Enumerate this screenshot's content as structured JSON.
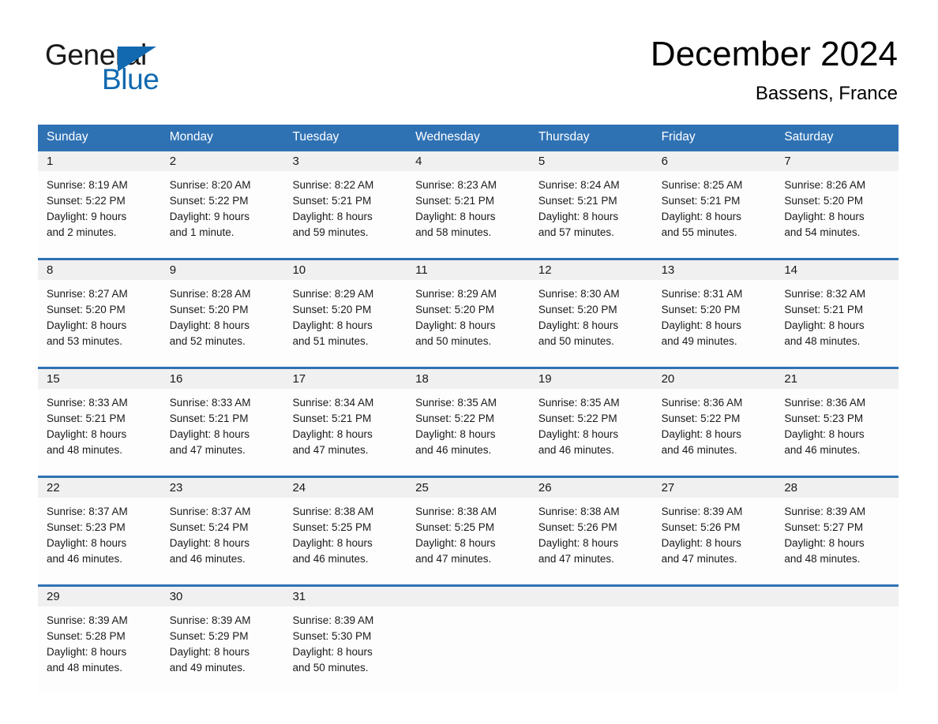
{
  "brand": {
    "name_part1": "General",
    "name_part2": "Blue",
    "triangle_icon": "triangle-icon",
    "accent_color": "#1269b0"
  },
  "header": {
    "month_title": "December 2024",
    "location": "Bassens, France"
  },
  "theme": {
    "header_blue": "#2f72b4",
    "daynum_band": "#f0f0f0",
    "cell_bg": "#fdfdfd",
    "text": "#1a1a1a"
  },
  "weekdays": [
    "Sunday",
    "Monday",
    "Tuesday",
    "Wednesday",
    "Thursday",
    "Friday",
    "Saturday"
  ],
  "weeks": [
    {
      "days": [
        {
          "num": "1",
          "sunrise": "Sunrise: 8:19 AM",
          "sunset": "Sunset: 5:22 PM",
          "daylight_line1": "Daylight: 9 hours",
          "daylight_line2": "and 2 minutes."
        },
        {
          "num": "2",
          "sunrise": "Sunrise: 8:20 AM",
          "sunset": "Sunset: 5:22 PM",
          "daylight_line1": "Daylight: 9 hours",
          "daylight_line2": "and 1 minute."
        },
        {
          "num": "3",
          "sunrise": "Sunrise: 8:22 AM",
          "sunset": "Sunset: 5:21 PM",
          "daylight_line1": "Daylight: 8 hours",
          "daylight_line2": "and 59 minutes."
        },
        {
          "num": "4",
          "sunrise": "Sunrise: 8:23 AM",
          "sunset": "Sunset: 5:21 PM",
          "daylight_line1": "Daylight: 8 hours",
          "daylight_line2": "and 58 minutes."
        },
        {
          "num": "5",
          "sunrise": "Sunrise: 8:24 AM",
          "sunset": "Sunset: 5:21 PM",
          "daylight_line1": "Daylight: 8 hours",
          "daylight_line2": "and 57 minutes."
        },
        {
          "num": "6",
          "sunrise": "Sunrise: 8:25 AM",
          "sunset": "Sunset: 5:21 PM",
          "daylight_line1": "Daylight: 8 hours",
          "daylight_line2": "and 55 minutes."
        },
        {
          "num": "7",
          "sunrise": "Sunrise: 8:26 AM",
          "sunset": "Sunset: 5:20 PM",
          "daylight_line1": "Daylight: 8 hours",
          "daylight_line2": "and 54 minutes."
        }
      ]
    },
    {
      "days": [
        {
          "num": "8",
          "sunrise": "Sunrise: 8:27 AM",
          "sunset": "Sunset: 5:20 PM",
          "daylight_line1": "Daylight: 8 hours",
          "daylight_line2": "and 53 minutes."
        },
        {
          "num": "9",
          "sunrise": "Sunrise: 8:28 AM",
          "sunset": "Sunset: 5:20 PM",
          "daylight_line1": "Daylight: 8 hours",
          "daylight_line2": "and 52 minutes."
        },
        {
          "num": "10",
          "sunrise": "Sunrise: 8:29 AM",
          "sunset": "Sunset: 5:20 PM",
          "daylight_line1": "Daylight: 8 hours",
          "daylight_line2": "and 51 minutes."
        },
        {
          "num": "11",
          "sunrise": "Sunrise: 8:29 AM",
          "sunset": "Sunset: 5:20 PM",
          "daylight_line1": "Daylight: 8 hours",
          "daylight_line2": "and 50 minutes."
        },
        {
          "num": "12",
          "sunrise": "Sunrise: 8:30 AM",
          "sunset": "Sunset: 5:20 PM",
          "daylight_line1": "Daylight: 8 hours",
          "daylight_line2": "and 50 minutes."
        },
        {
          "num": "13",
          "sunrise": "Sunrise: 8:31 AM",
          "sunset": "Sunset: 5:20 PM",
          "daylight_line1": "Daylight: 8 hours",
          "daylight_line2": "and 49 minutes."
        },
        {
          "num": "14",
          "sunrise": "Sunrise: 8:32 AM",
          "sunset": "Sunset: 5:21 PM",
          "daylight_line1": "Daylight: 8 hours",
          "daylight_line2": "and 48 minutes."
        }
      ]
    },
    {
      "days": [
        {
          "num": "15",
          "sunrise": "Sunrise: 8:33 AM",
          "sunset": "Sunset: 5:21 PM",
          "daylight_line1": "Daylight: 8 hours",
          "daylight_line2": "and 48 minutes."
        },
        {
          "num": "16",
          "sunrise": "Sunrise: 8:33 AM",
          "sunset": "Sunset: 5:21 PM",
          "daylight_line1": "Daylight: 8 hours",
          "daylight_line2": "and 47 minutes."
        },
        {
          "num": "17",
          "sunrise": "Sunrise: 8:34 AM",
          "sunset": "Sunset: 5:21 PM",
          "daylight_line1": "Daylight: 8 hours",
          "daylight_line2": "and 47 minutes."
        },
        {
          "num": "18",
          "sunrise": "Sunrise: 8:35 AM",
          "sunset": "Sunset: 5:22 PM",
          "daylight_line1": "Daylight: 8 hours",
          "daylight_line2": "and 46 minutes."
        },
        {
          "num": "19",
          "sunrise": "Sunrise: 8:35 AM",
          "sunset": "Sunset: 5:22 PM",
          "daylight_line1": "Daylight: 8 hours",
          "daylight_line2": "and 46 minutes."
        },
        {
          "num": "20",
          "sunrise": "Sunrise: 8:36 AM",
          "sunset": "Sunset: 5:22 PM",
          "daylight_line1": "Daylight: 8 hours",
          "daylight_line2": "and 46 minutes."
        },
        {
          "num": "21",
          "sunrise": "Sunrise: 8:36 AM",
          "sunset": "Sunset: 5:23 PM",
          "daylight_line1": "Daylight: 8 hours",
          "daylight_line2": "and 46 minutes."
        }
      ]
    },
    {
      "days": [
        {
          "num": "22",
          "sunrise": "Sunrise: 8:37 AM",
          "sunset": "Sunset: 5:23 PM",
          "daylight_line1": "Daylight: 8 hours",
          "daylight_line2": "and 46 minutes."
        },
        {
          "num": "23",
          "sunrise": "Sunrise: 8:37 AM",
          "sunset": "Sunset: 5:24 PM",
          "daylight_line1": "Daylight: 8 hours",
          "daylight_line2": "and 46 minutes."
        },
        {
          "num": "24",
          "sunrise": "Sunrise: 8:38 AM",
          "sunset": "Sunset: 5:25 PM",
          "daylight_line1": "Daylight: 8 hours",
          "daylight_line2": "and 46 minutes."
        },
        {
          "num": "25",
          "sunrise": "Sunrise: 8:38 AM",
          "sunset": "Sunset: 5:25 PM",
          "daylight_line1": "Daylight: 8 hours",
          "daylight_line2": "and 47 minutes."
        },
        {
          "num": "26",
          "sunrise": "Sunrise: 8:38 AM",
          "sunset": "Sunset: 5:26 PM",
          "daylight_line1": "Daylight: 8 hours",
          "daylight_line2": "and 47 minutes."
        },
        {
          "num": "27",
          "sunrise": "Sunrise: 8:39 AM",
          "sunset": "Sunset: 5:26 PM",
          "daylight_line1": "Daylight: 8 hours",
          "daylight_line2": "and 47 minutes."
        },
        {
          "num": "28",
          "sunrise": "Sunrise: 8:39 AM",
          "sunset": "Sunset: 5:27 PM",
          "daylight_line1": "Daylight: 8 hours",
          "daylight_line2": "and 48 minutes."
        }
      ]
    },
    {
      "days": [
        {
          "num": "29",
          "sunrise": "Sunrise: 8:39 AM",
          "sunset": "Sunset: 5:28 PM",
          "daylight_line1": "Daylight: 8 hours",
          "daylight_line2": "and 48 minutes."
        },
        {
          "num": "30",
          "sunrise": "Sunrise: 8:39 AM",
          "sunset": "Sunset: 5:29 PM",
          "daylight_line1": "Daylight: 8 hours",
          "daylight_line2": "and 49 minutes."
        },
        {
          "num": "31",
          "sunrise": "Sunrise: 8:39 AM",
          "sunset": "Sunset: 5:30 PM",
          "daylight_line1": "Daylight: 8 hours",
          "daylight_line2": "and 50 minutes."
        },
        {
          "num": "",
          "sunrise": "",
          "sunset": "",
          "daylight_line1": "",
          "daylight_line2": ""
        },
        {
          "num": "",
          "sunrise": "",
          "sunset": "",
          "daylight_line1": "",
          "daylight_line2": ""
        },
        {
          "num": "",
          "sunrise": "",
          "sunset": "",
          "daylight_line1": "",
          "daylight_line2": ""
        },
        {
          "num": "",
          "sunrise": "",
          "sunset": "",
          "daylight_line1": "",
          "daylight_line2": ""
        }
      ]
    }
  ]
}
